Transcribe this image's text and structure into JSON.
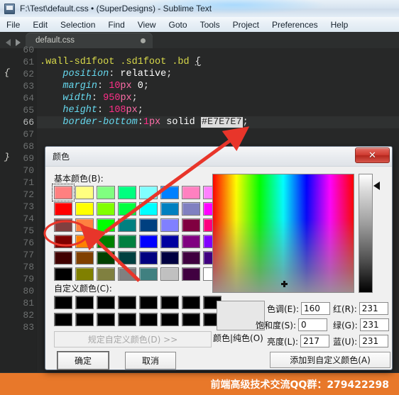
{
  "window": {
    "title": "F:\\Test\\default.css • (SuperDesigns) - Sublime Text",
    "icon": "sublime-icon"
  },
  "menubar": {
    "items": [
      "File",
      "Edit",
      "Selection",
      "Find",
      "View",
      "Goto",
      "Tools",
      "Project",
      "Preferences",
      "Help"
    ]
  },
  "tabbar": {
    "prev_arrow": "prev-arrow-icon",
    "next_arrow": "next-arrow-icon",
    "tab_label": "default.css",
    "modified_dot": "modified-dot-icon"
  },
  "editor": {
    "fold_marker": "{",
    "fold_marker_close": "}",
    "line_numbers": [
      "60",
      "61",
      "62",
      "63",
      "64",
      "65",
      "66",
      "67",
      "68",
      "69",
      "70",
      "71",
      "72",
      "73",
      "74",
      "75",
      "76",
      "77",
      "78",
      "79",
      "80",
      "81",
      "82",
      "83"
    ],
    "current_line": "66",
    "lines": [
      {
        "num": "61",
        "tokens": [
          {
            "t": ".wall-sd1foot .sd1foot .bd ",
            "c": "t-sel"
          },
          {
            "t": "{",
            "c": "t-brace"
          }
        ]
      },
      {
        "num": "62",
        "tokens": [
          {
            "t": "    ",
            "c": "t-punc"
          },
          {
            "t": "position",
            "c": "t-prop"
          },
          {
            "t": ": ",
            "c": "t-punc"
          },
          {
            "t": "relative",
            "c": "t-val"
          },
          {
            "t": ";",
            "c": "t-punc"
          }
        ]
      },
      {
        "num": "63",
        "tokens": [
          {
            "t": "    ",
            "c": "t-punc"
          },
          {
            "t": "margin",
            "c": "t-prop"
          },
          {
            "t": ": ",
            "c": "t-punc"
          },
          {
            "t": "10",
            "c": "t-num"
          },
          {
            "t": "px",
            "c": "t-unit"
          },
          {
            "t": " 0",
            "c": "t-val"
          },
          {
            "t": ";",
            "c": "t-punc"
          }
        ]
      },
      {
        "num": "64",
        "tokens": [
          {
            "t": "    ",
            "c": "t-punc"
          },
          {
            "t": "width",
            "c": "t-prop"
          },
          {
            "t": ": ",
            "c": "t-punc"
          },
          {
            "t": "950",
            "c": "t-num"
          },
          {
            "t": "px",
            "c": "t-unit"
          },
          {
            "t": ";",
            "c": "t-punc"
          }
        ]
      },
      {
        "num": "65",
        "tokens": [
          {
            "t": "    ",
            "c": "t-punc"
          },
          {
            "t": "height",
            "c": "t-prop"
          },
          {
            "t": ": ",
            "c": "t-punc"
          },
          {
            "t": "108",
            "c": "t-num"
          },
          {
            "t": "px",
            "c": "t-unit"
          },
          {
            "t": ";",
            "c": "t-punc"
          }
        ]
      },
      {
        "num": "66",
        "tokens": [
          {
            "t": "    ",
            "c": "t-punc"
          },
          {
            "t": "border-bottom",
            "c": "t-prop"
          },
          {
            "t": ":",
            "c": "t-punc"
          },
          {
            "t": "1",
            "c": "t-num"
          },
          {
            "t": "px",
            "c": "t-unit"
          },
          {
            "t": " solid ",
            "c": "t-val"
          },
          {
            "t": "#E7E7E7",
            "c": "hl-hex"
          },
          {
            "t": ";",
            "c": "t-punc"
          }
        ]
      }
    ],
    "selected_value": "#E7E7E7"
  },
  "banner": {
    "text": "前端高级技术交流QQ群：279422298",
    "background": "#e8782a",
    "color": "#ffffff"
  },
  "dialog": {
    "title": "颜色",
    "close_label": "✕",
    "basic_colors_label": "基本颜色(B):",
    "custom_colors_label": "自定义颜色(C):",
    "define_custom_label": "规定自定义颜色(D) >>",
    "ok_label": "确定",
    "cancel_label": "取消",
    "add_to_custom_label": "添加到自定义颜色(A)",
    "preview_label": "颜色|纯色(O)",
    "preview_color": "#e7e7e7",
    "basic_colors": [
      "#FF8080",
      "#FFFF80",
      "#80FF80",
      "#00FF80",
      "#80FFFF",
      "#0080FF",
      "#FF80C0",
      "#FF80FF",
      "#FF0000",
      "#FFFF00",
      "#80FF00",
      "#00FF40",
      "#00FFFF",
      "#0080C0",
      "#8080C0",
      "#FF00FF",
      "#804040",
      "#FF8040",
      "#00FF00",
      "#008080",
      "#004080",
      "#8080FF",
      "#800040",
      "#FF0080",
      "#800000",
      "#FF8000",
      "#008000",
      "#008040",
      "#0000FF",
      "#0000A0",
      "#800080",
      "#8000FF",
      "#400000",
      "#804000",
      "#004000",
      "#004040",
      "#000080",
      "#000040",
      "#400040",
      "#400080",
      "#000000",
      "#808000",
      "#808040",
      "#808080",
      "#408080",
      "#C0C0C0",
      "#400040",
      "#FFFFFF"
    ],
    "custom_colors": [
      "#000000",
      "#000000",
      "#000000",
      "#000000",
      "#000000",
      "#000000",
      "#000000",
      "#000000",
      "#000000",
      "#000000",
      "#000000",
      "#000000",
      "#000000",
      "#000000",
      "#000000",
      "#000000"
    ],
    "selected_swatch_index": 0,
    "circled_swatch_index": 24,
    "fields": [
      {
        "label": "色调(E):",
        "value": "160",
        "name": "hue-field"
      },
      {
        "label": "红(R):",
        "value": "231",
        "name": "red-field"
      },
      {
        "label": "饱和度(S):",
        "value": "0",
        "name": "saturation-field"
      },
      {
        "label": "绿(G):",
        "value": "231",
        "name": "green-field"
      },
      {
        "label": "亮度(L):",
        "value": "217",
        "name": "luminance-field"
      },
      {
        "label": "蓝(U):",
        "value": "231",
        "name": "blue-field"
      }
    ]
  },
  "annotations": {
    "arrow_color": "#e8352a",
    "arrow1": "arrow pointing from basic color swatch to #E7E7E7 in code",
    "arrow2": "arrow pointing to circled swatch",
    "ellipse": "red ellipse highlighting dark red swatch"
  }
}
